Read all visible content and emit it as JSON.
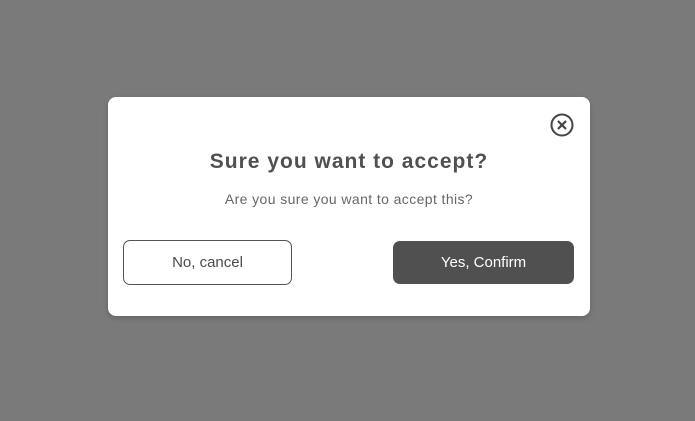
{
  "dialog": {
    "title": "Sure you want to accept?",
    "message": "Are you sure you want to accept this?",
    "close_icon": "close-circle-icon",
    "cancel_label": "No, cancel",
    "confirm_label": "Yes, Confirm"
  },
  "colors": {
    "overlay": "#7a7a7a",
    "dialog_bg": "#ffffff",
    "title_text": "#505050",
    "confirm_bg": "#505050",
    "confirm_text": "#ffffff",
    "cancel_border": "#555555"
  }
}
